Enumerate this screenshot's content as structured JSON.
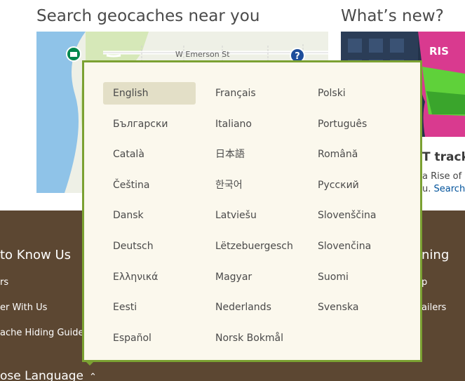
{
  "sections": {
    "search_heading": "Search geocaches near you",
    "news_heading": "What’s new?"
  },
  "map": {
    "street_label": "W Emerson St"
  },
  "news": {
    "title_fragment": "T tracka",
    "line1": "a Rise of",
    "line2_prefix": "u.",
    "line2_link": "Search"
  },
  "footer": {
    "col1_heading": "to Know Us",
    "col1_links": [
      "rs",
      "er With Us",
      "ache Hiding Guide"
    ],
    "col3_heading": "ning",
    "col3_links": [
      "p",
      "ailers"
    ],
    "language_toggle": "ose Language"
  },
  "language_menu": {
    "selected": "English",
    "columns": [
      [
        "English",
        "Български",
        "Català",
        "Čeština",
        "Dansk",
        "Deutsch",
        "Ελληνικά",
        "Eesti",
        "Español"
      ],
      [
        "Français",
        "Italiano",
        "日本語",
        "한국어",
        "Latviešu",
        "Lëtzebuergesch",
        "Magyar",
        "Nederlands",
        "Norsk Bokmål"
      ],
      [
        "Polski",
        "Português",
        "Română",
        "Русский",
        "Slovenščina",
        "Slovenčina",
        "Suomi",
        "Svenska"
      ]
    ]
  },
  "colors": {
    "footer_bg": "#5c4732",
    "popup_bg": "#fbf8ed",
    "popup_border": "#7ba132",
    "selected_bg": "#e3dfc7",
    "link": "#00529b"
  }
}
